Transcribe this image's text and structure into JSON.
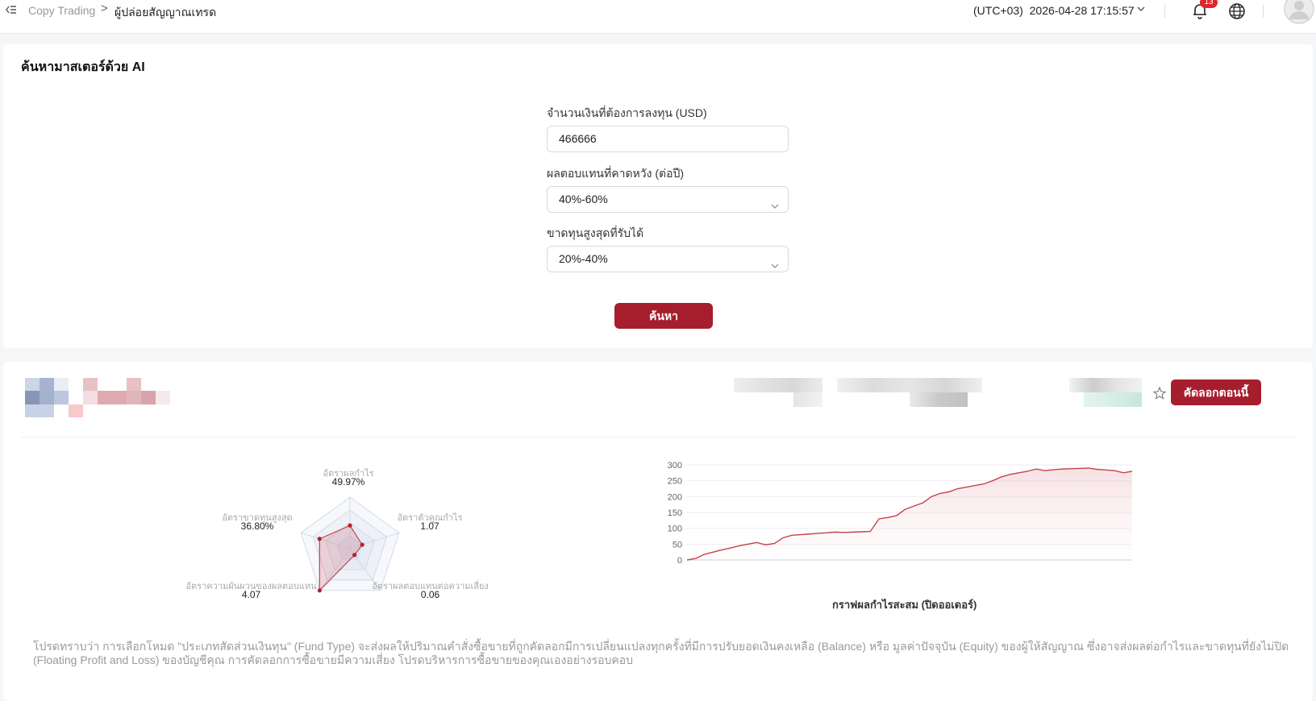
{
  "topbar": {
    "back_icon": "collapse-menu-icon",
    "breadcrumb_root": "Copy Trading",
    "breadcrumb_separator": ">",
    "breadcrumb_current": "ผู้ปล่อยสัญญาณเทรด",
    "timezone": "(UTC+03)",
    "datetime": "2026-04-28 17:15:57",
    "notification_count": "13",
    "icons": [
      "bell-icon",
      "globe-icon",
      "avatar"
    ]
  },
  "search_card": {
    "title": "ค้นหามาสเตอร์ด้วย AI",
    "amount_label": "จำนวนเงินที่ต้องการลงทุน (USD)",
    "amount_value": "466666",
    "return_label": "ผลตอบแทนที่คาดหวัง (ต่อปี)",
    "return_value": "40%-60%",
    "drawdown_label": "ขาดทุนสูงสุดที่รับได้",
    "drawdown_value": "20%-40%",
    "search_button": "ค้นหา"
  },
  "result_card": {
    "copy_button": "คัดลอกตอนนี้",
    "radar": {
      "metrics": [
        {
          "label": "อัตราผลกำไร",
          "value": "49.97%",
          "score": 0.45
        },
        {
          "label": "อัตราตัวคูณกำไร",
          "value": "1.07",
          "score": 0.25
        },
        {
          "label": "อัตราผลตอบแทนต่อความเสี่ยง",
          "value": "0.06",
          "score": 0.15
        },
        {
          "label": "อัตราความผันผวนของผลตอบแทน",
          "value": "4.07",
          "score": 1.0
        },
        {
          "label": "อัตราขาดทุนสูงสุด",
          "value": "36.80%",
          "score": 0.62
        }
      ]
    },
    "chart_caption": "กราฟผลกำไรสะสม (ปิดออเดอร์)",
    "accent_color": "#a61e2d"
  },
  "chart_data": {
    "type": "area",
    "title": "",
    "xlabel": "",
    "ylabel": "",
    "ylim": [
      0,
      300
    ],
    "yticks": [
      0,
      50,
      100,
      150,
      200,
      250,
      300
    ],
    "series": [
      {
        "values": [
          0,
          5,
          18,
          25,
          32,
          38,
          45,
          50,
          55,
          48,
          52,
          70,
          78,
          80,
          82,
          84,
          86,
          88,
          87,
          88,
          89,
          90,
          130,
          134,
          140,
          160,
          170,
          180,
          200,
          210,
          215,
          225,
          230,
          235,
          240,
          250,
          262,
          270,
          275,
          280,
          287,
          282,
          285,
          287,
          288,
          289,
          290,
          286,
          284,
          282,
          275,
          280
        ]
      }
    ]
  },
  "disclaimer": "โปรดทราบว่า การเลือกโหมด \"ประเภทสัดส่วนเงินทุน\" (Fund Type) จะส่งผลให้ปริมาณคำสั่งซื้อขายที่ถูกคัดลอกมีการเปลี่ยนแปลงทุกครั้งที่มีการปรับยอดเงินคงเหลือ (Balance) หรือ มูลค่าปัจจุบัน (Equity) ของผู้ให้สัญญาณ ซึ่งอาจส่งผลต่อกำไรและขาดทุนที่ยังไม่ปิด (Floating Profit and Loss) ของบัญชีคุณ การคัดลอกการซื้อขายมีความเสี่ยง โปรดบริหารการซื้อขายของคุณเองอย่างรอบคอบ"
}
